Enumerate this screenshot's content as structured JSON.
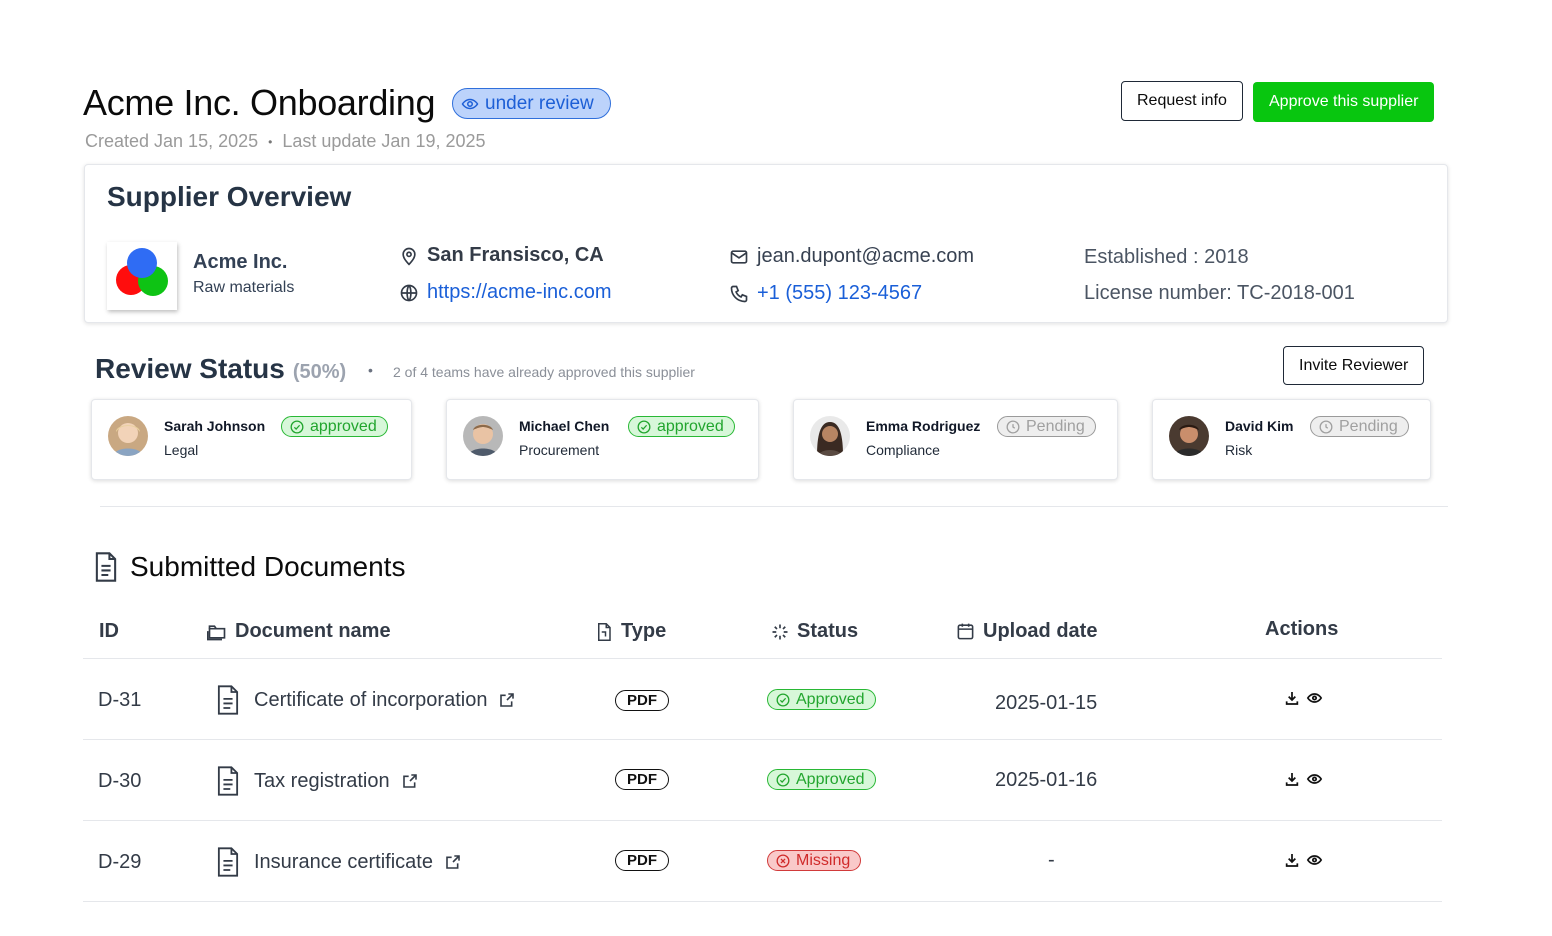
{
  "header": {
    "title": "Acme Inc. Onboarding",
    "status_label": "under review",
    "created": "Created Jan 15, 2025",
    "separator": "•",
    "last_update": "Last update Jan 19, 2025",
    "request_info_label": "Request info",
    "approve_label": "Approve this supplier",
    "colors": {
      "approve": "#08c60f",
      "status_pill_bg": "#bcd3fb",
      "status_pill_text": "#1d5fd6"
    }
  },
  "overview": {
    "title": "Supplier Overview",
    "company_name": "Acme Inc.",
    "company_category": "Raw materials",
    "location": "San Fransisco, CA",
    "website": "https://acme-inc.com",
    "email": "jean.dupont@acme.com",
    "phone": "+1 (555) 123-4567",
    "established": "Established : 2018",
    "license": "License number: TC-2018-001",
    "icons": [
      "map-pin-icon",
      "globe-icon",
      "mail-icon",
      "phone-icon"
    ]
  },
  "review": {
    "title": "Review Status",
    "percent": "(50%)",
    "separator": "•",
    "note": "2 of 4 teams have already approved this supplier",
    "invite_label": "Invite Reviewer",
    "reviewers": [
      {
        "name": "Sarah Johnson",
        "role": "Legal",
        "status": "approved"
      },
      {
        "name": "Michael Chen",
        "role": "Procurement",
        "status": "approved"
      },
      {
        "name": "Emma Rodriguez",
        "role": "Compliance",
        "status": "Pending"
      },
      {
        "name": "David Kim",
        "role": "Risk",
        "status": "Pending"
      }
    ]
  },
  "documents": {
    "title": "Submitted Documents",
    "columns": {
      "id": "ID",
      "name": "Document name",
      "type": "Type",
      "status": "Status",
      "upload": "Upload date",
      "actions": "Actions"
    },
    "rows": [
      {
        "id": "D-31",
        "name": "Certificate of incorporation",
        "type": "PDF",
        "status": "Approved",
        "date": "2025-01-15"
      },
      {
        "id": "D-30",
        "name": "Tax registration",
        "type": "PDF",
        "status": "Approved",
        "date": "2025-01-16"
      },
      {
        "id": "D-29",
        "name": "Insurance certificate",
        "type": "PDF",
        "status": "Missing",
        "date": "-"
      }
    ]
  }
}
